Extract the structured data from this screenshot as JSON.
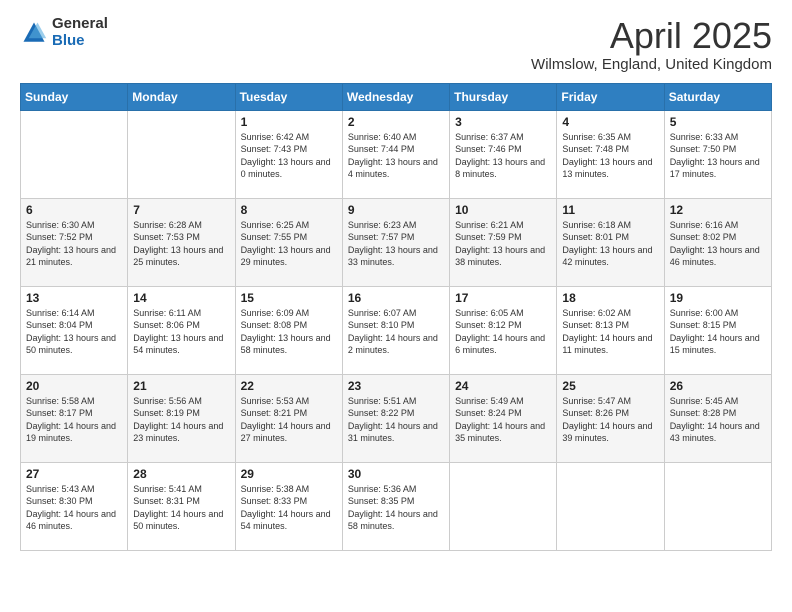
{
  "logo": {
    "general": "General",
    "blue": "Blue"
  },
  "title": "April 2025",
  "location": "Wilmslow, England, United Kingdom",
  "weekdays": [
    "Sunday",
    "Monday",
    "Tuesday",
    "Wednesday",
    "Thursday",
    "Friday",
    "Saturday"
  ],
  "weeks": [
    [
      {
        "day": "",
        "info": ""
      },
      {
        "day": "",
        "info": ""
      },
      {
        "day": "1",
        "info": "Sunrise: 6:42 AM\nSunset: 7:43 PM\nDaylight: 13 hours and 0 minutes."
      },
      {
        "day": "2",
        "info": "Sunrise: 6:40 AM\nSunset: 7:44 PM\nDaylight: 13 hours and 4 minutes."
      },
      {
        "day": "3",
        "info": "Sunrise: 6:37 AM\nSunset: 7:46 PM\nDaylight: 13 hours and 8 minutes."
      },
      {
        "day": "4",
        "info": "Sunrise: 6:35 AM\nSunset: 7:48 PM\nDaylight: 13 hours and 13 minutes."
      },
      {
        "day": "5",
        "info": "Sunrise: 6:33 AM\nSunset: 7:50 PM\nDaylight: 13 hours and 17 minutes."
      }
    ],
    [
      {
        "day": "6",
        "info": "Sunrise: 6:30 AM\nSunset: 7:52 PM\nDaylight: 13 hours and 21 minutes."
      },
      {
        "day": "7",
        "info": "Sunrise: 6:28 AM\nSunset: 7:53 PM\nDaylight: 13 hours and 25 minutes."
      },
      {
        "day": "8",
        "info": "Sunrise: 6:25 AM\nSunset: 7:55 PM\nDaylight: 13 hours and 29 minutes."
      },
      {
        "day": "9",
        "info": "Sunrise: 6:23 AM\nSunset: 7:57 PM\nDaylight: 13 hours and 33 minutes."
      },
      {
        "day": "10",
        "info": "Sunrise: 6:21 AM\nSunset: 7:59 PM\nDaylight: 13 hours and 38 minutes."
      },
      {
        "day": "11",
        "info": "Sunrise: 6:18 AM\nSunset: 8:01 PM\nDaylight: 13 hours and 42 minutes."
      },
      {
        "day": "12",
        "info": "Sunrise: 6:16 AM\nSunset: 8:02 PM\nDaylight: 13 hours and 46 minutes."
      }
    ],
    [
      {
        "day": "13",
        "info": "Sunrise: 6:14 AM\nSunset: 8:04 PM\nDaylight: 13 hours and 50 minutes."
      },
      {
        "day": "14",
        "info": "Sunrise: 6:11 AM\nSunset: 8:06 PM\nDaylight: 13 hours and 54 minutes."
      },
      {
        "day": "15",
        "info": "Sunrise: 6:09 AM\nSunset: 8:08 PM\nDaylight: 13 hours and 58 minutes."
      },
      {
        "day": "16",
        "info": "Sunrise: 6:07 AM\nSunset: 8:10 PM\nDaylight: 14 hours and 2 minutes."
      },
      {
        "day": "17",
        "info": "Sunrise: 6:05 AM\nSunset: 8:12 PM\nDaylight: 14 hours and 6 minutes."
      },
      {
        "day": "18",
        "info": "Sunrise: 6:02 AM\nSunset: 8:13 PM\nDaylight: 14 hours and 11 minutes."
      },
      {
        "day": "19",
        "info": "Sunrise: 6:00 AM\nSunset: 8:15 PM\nDaylight: 14 hours and 15 minutes."
      }
    ],
    [
      {
        "day": "20",
        "info": "Sunrise: 5:58 AM\nSunset: 8:17 PM\nDaylight: 14 hours and 19 minutes."
      },
      {
        "day": "21",
        "info": "Sunrise: 5:56 AM\nSunset: 8:19 PM\nDaylight: 14 hours and 23 minutes."
      },
      {
        "day": "22",
        "info": "Sunrise: 5:53 AM\nSunset: 8:21 PM\nDaylight: 14 hours and 27 minutes."
      },
      {
        "day": "23",
        "info": "Sunrise: 5:51 AM\nSunset: 8:22 PM\nDaylight: 14 hours and 31 minutes."
      },
      {
        "day": "24",
        "info": "Sunrise: 5:49 AM\nSunset: 8:24 PM\nDaylight: 14 hours and 35 minutes."
      },
      {
        "day": "25",
        "info": "Sunrise: 5:47 AM\nSunset: 8:26 PM\nDaylight: 14 hours and 39 minutes."
      },
      {
        "day": "26",
        "info": "Sunrise: 5:45 AM\nSunset: 8:28 PM\nDaylight: 14 hours and 43 minutes."
      }
    ],
    [
      {
        "day": "27",
        "info": "Sunrise: 5:43 AM\nSunset: 8:30 PM\nDaylight: 14 hours and 46 minutes."
      },
      {
        "day": "28",
        "info": "Sunrise: 5:41 AM\nSunset: 8:31 PM\nDaylight: 14 hours and 50 minutes."
      },
      {
        "day": "29",
        "info": "Sunrise: 5:38 AM\nSunset: 8:33 PM\nDaylight: 14 hours and 54 minutes."
      },
      {
        "day": "30",
        "info": "Sunrise: 5:36 AM\nSunset: 8:35 PM\nDaylight: 14 hours and 58 minutes."
      },
      {
        "day": "",
        "info": ""
      },
      {
        "day": "",
        "info": ""
      },
      {
        "day": "",
        "info": ""
      }
    ]
  ]
}
